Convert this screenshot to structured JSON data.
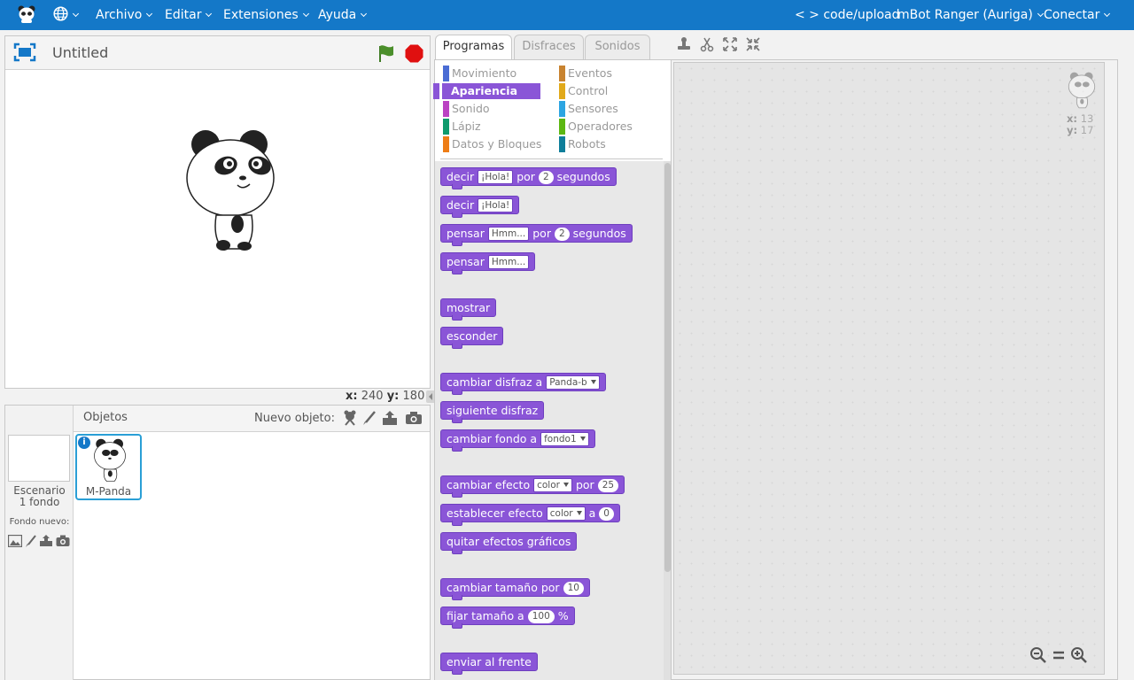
{
  "menu": {
    "archivo": "Archivo",
    "editar": "Editar",
    "extensiones": "Extensiones",
    "ayuda": "Ayuda",
    "code_upload": "< > code/upload",
    "board": "mBot Ranger (Auriga)",
    "conectar": "Conectar"
  },
  "stage": {
    "title": "Untitled",
    "x_label": "x:",
    "x_value": "240",
    "y_label": "y:",
    "y_value": "180"
  },
  "sprites": {
    "header": "Objetos",
    "new_object_label": "Nuevo objeto:",
    "stage_name": "Escenario",
    "stage_backdrops": "1 fondo",
    "new_backdrop_label": "Fondo nuevo:",
    "selected_sprite": "M-Panda"
  },
  "tabs": {
    "programas": "Programas",
    "disfraces": "Disfraces",
    "sonidos": "Sonidos"
  },
  "categories": {
    "movimiento": "Movimiento",
    "apariencia": "Apariencia",
    "sonido": "Sonido",
    "lapiz": "Lápiz",
    "datos": "Datos y Bloques",
    "eventos": "Eventos",
    "control": "Control",
    "sensores": "Sensores",
    "operadores": "Operadores",
    "robots": "Robots"
  },
  "category_colors": {
    "movimiento": "#4a6cd4",
    "apariencia": "#8a55d7",
    "sonido": "#bb42c3",
    "lapiz": "#0e9a6c",
    "datos": "#ee7d16",
    "eventos": "#c88330",
    "control": "#e1a91a",
    "sensores": "#2ca5e2",
    "operadores": "#5cb712",
    "robots": "#0e7e9a"
  },
  "blocks": {
    "b1": {
      "w1": "decir",
      "f1": "¡Hola!",
      "w2": "por",
      "n1": "2",
      "w3": "segundos"
    },
    "b2": {
      "w1": "decir",
      "f1": "¡Hola!"
    },
    "b3": {
      "w1": "pensar",
      "f1": "Hmm...",
      "w2": "por",
      "n1": "2",
      "w3": "segundos"
    },
    "b4": {
      "w1": "pensar",
      "f1": "Hmm..."
    },
    "b5": {
      "w1": "mostrar"
    },
    "b6": {
      "w1": "esconder"
    },
    "b7": {
      "w1": "cambiar disfraz a",
      "d1": "Panda-b"
    },
    "b8": {
      "w1": "siguiente disfraz"
    },
    "b9": {
      "w1": "cambiar fondo a",
      "d1": "fondo1"
    },
    "b10": {
      "w1": "cambiar efecto",
      "d1": "color",
      "w2": "por",
      "n1": "25"
    },
    "b11": {
      "w1": "establecer efecto",
      "d1": "color",
      "w2": "a",
      "n1": "0"
    },
    "b12": {
      "w1": "quitar efectos gráficos"
    },
    "b13": {
      "w1": "cambiar tamaño por",
      "n1": "10"
    },
    "b14": {
      "w1": "fijar tamaño a",
      "n1": "100",
      "w2": "%"
    },
    "b15": {
      "w1": "enviar al frente"
    }
  },
  "script_area": {
    "x_label": "x:",
    "x_value": "13",
    "y_label": "y:",
    "y_value": "17"
  }
}
